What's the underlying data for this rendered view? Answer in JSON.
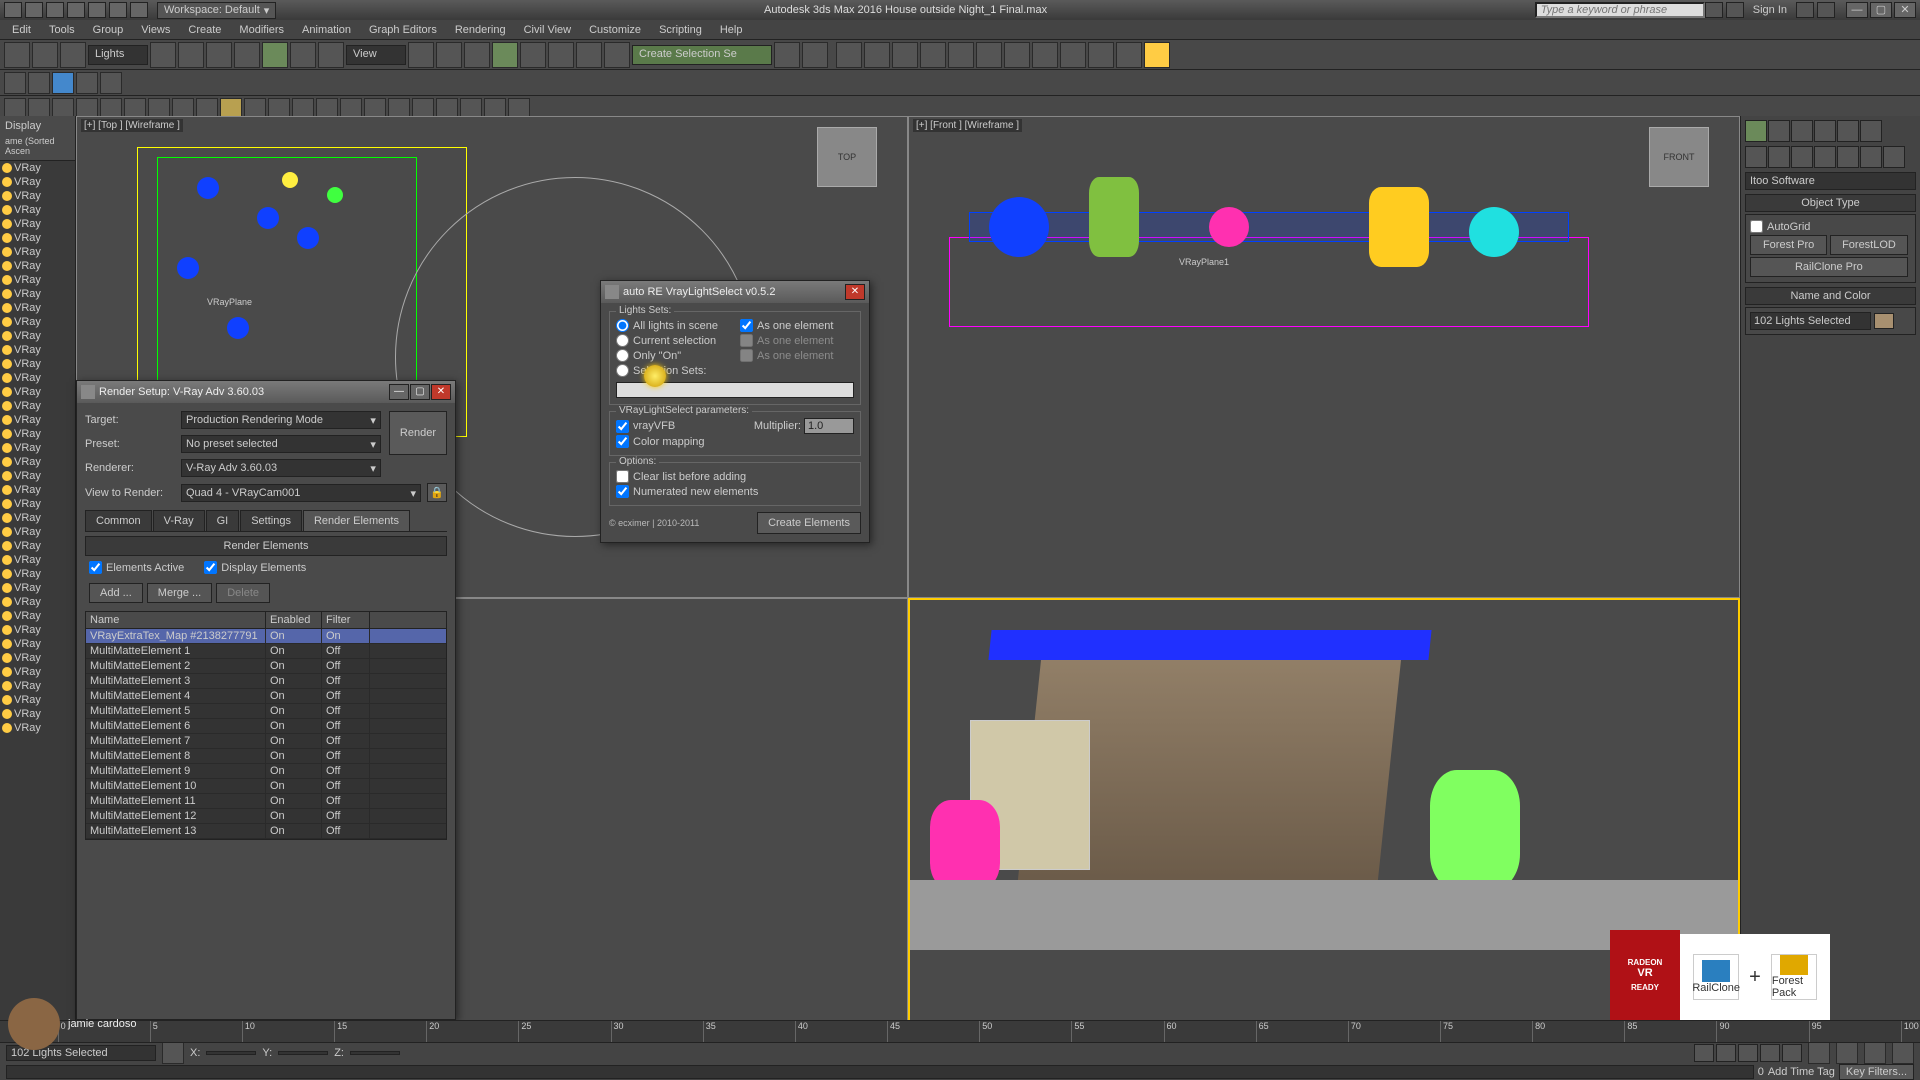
{
  "app": {
    "title": "Autodesk 3ds Max 2016   House outside Night_1 Final.max",
    "workspace_label": "Workspace: Default",
    "search_placeholder": "Type a keyword or phrase",
    "sign_in": "Sign In"
  },
  "menu": [
    "Edit",
    "Tools",
    "Group",
    "Views",
    "Create",
    "Modifiers",
    "Animation",
    "Graph Editors",
    "Rendering",
    "Civil View",
    "Customize",
    "Scripting",
    "Help"
  ],
  "toolbar_dropdowns": {
    "lights": "Lights",
    "view": "View",
    "selset": "Create Selection Se"
  },
  "scene_explorer": {
    "header1": "Display",
    "header2": "ame (Sorted Ascen",
    "items": [
      "VRay",
      "VRay",
      "VRay",
      "VRay",
      "VRay",
      "VRay",
      "VRay",
      "VRay",
      "VRay",
      "VRay",
      "VRay",
      "VRay",
      "VRay",
      "VRay",
      "VRay",
      "VRay",
      "VRay",
      "VRay",
      "VRay",
      "VRay",
      "VRay",
      "VRay",
      "VRay",
      "VRay",
      "VRay",
      "VRay",
      "VRay",
      "VRay",
      "VRay",
      "VRay",
      "VRay",
      "VRay",
      "VRay",
      "VRay",
      "VRay",
      "VRay",
      "VRay",
      "VRay",
      "VRay",
      "VRay",
      "VRay"
    ]
  },
  "viewports": {
    "tl": "[+] [Top ] [Wireframe ]",
    "tr": "[+] [Front ] [Wireframe ]",
    "tl_text": "VRayPlane",
    "tr_text": "VRayPlane1",
    "viewcube_top": "TOP",
    "viewcube_front": "FRONT"
  },
  "cmd_panel": {
    "category": "Itoo Software",
    "rollout_objtype": "Object Type",
    "autogrid": "AutoGrid",
    "buttons": [
      "Forest Pro",
      "ForestLOD",
      "RailClone Pro"
    ],
    "rollout_name": "Name and Color",
    "name_value": "102 Lights Selected"
  },
  "render_setup": {
    "title": "Render Setup: V-Ray Adv 3.60.03",
    "labels": {
      "target": "Target:",
      "preset": "Preset:",
      "renderer": "Renderer:",
      "view": "View to Render:"
    },
    "target": "Production Rendering Mode",
    "preset": "No preset selected",
    "renderer": "V-Ray Adv 3.60.03",
    "view": "Quad 4 - VRayCam001",
    "render_btn": "Render",
    "tabs": [
      "Common",
      "V-Ray",
      "GI",
      "Settings",
      "Render Elements"
    ],
    "active_tab": 4,
    "rollout": "Render Elements",
    "elements_active": "Elements Active",
    "display_elements": "Display Elements",
    "btn_add": "Add ...",
    "btn_merge": "Merge ...",
    "btn_delete": "Delete",
    "cols": {
      "name": "Name",
      "enabled": "Enabled",
      "filter": "Filter"
    },
    "rows": [
      {
        "name": "VRayExtraTex_Map #2138277791",
        "enabled": "On",
        "filter": "On"
      },
      {
        "name": "MultiMatteElement 1",
        "enabled": "On",
        "filter": "Off"
      },
      {
        "name": "MultiMatteElement 2",
        "enabled": "On",
        "filter": "Off"
      },
      {
        "name": "MultiMatteElement 3",
        "enabled": "On",
        "filter": "Off"
      },
      {
        "name": "MultiMatteElement 4",
        "enabled": "On",
        "filter": "Off"
      },
      {
        "name": "MultiMatteElement 5",
        "enabled": "On",
        "filter": "Off"
      },
      {
        "name": "MultiMatteElement 6",
        "enabled": "On",
        "filter": "Off"
      },
      {
        "name": "MultiMatteElement 7",
        "enabled": "On",
        "filter": "Off"
      },
      {
        "name": "MultiMatteElement 8",
        "enabled": "On",
        "filter": "Off"
      },
      {
        "name": "MultiMatteElement 9",
        "enabled": "On",
        "filter": "Off"
      },
      {
        "name": "MultiMatteElement 10",
        "enabled": "On",
        "filter": "Off"
      },
      {
        "name": "MultiMatteElement 11",
        "enabled": "On",
        "filter": "Off"
      },
      {
        "name": "MultiMatteElement 12",
        "enabled": "On",
        "filter": "Off"
      },
      {
        "name": "MultiMatteElement 13",
        "enabled": "On",
        "filter": "Off"
      }
    ]
  },
  "vls": {
    "title": "auto RE VrayLightSelect v0.5.2",
    "group_lights": "Lights Sets:",
    "radios": [
      "All lights in scene",
      "Current selection",
      "Only \"On\"",
      "Selection Sets:"
    ],
    "as_one": "As one element",
    "group_params": "VRayLightSelect parameters:",
    "vrayvfb": "vrayVFB",
    "multiplier_label": "Multiplier:",
    "multiplier": "1.0",
    "color_mapping": "Color mapping",
    "group_options": "Options:",
    "clear_list": "Clear list before adding",
    "numerated": "Numerated new elements",
    "credit": "© ecximer | 2010-2011",
    "create_btn": "Create Elements"
  },
  "timeline": {
    "ticks": [
      "0",
      "5",
      "10",
      "15",
      "20",
      "25",
      "30",
      "35",
      "40",
      "45",
      "50",
      "55",
      "60",
      "65",
      "70",
      "75",
      "80",
      "85",
      "90",
      "95",
      "100"
    ],
    "x": "X:",
    "y": "Y:",
    "z": "Z:",
    "selection": "102 Lights Selected",
    "frame": "0",
    "tags_label": "Add Time Tag",
    "keyfilters": "Key Filters..."
  },
  "overlays": {
    "vr_top": "RADEON",
    "vr": "VR",
    "vr_sub": "READY",
    "rc": "Rc",
    "rc_name": "RailClone",
    "plus": "+",
    "fp": "Fp",
    "fp_name": "Forest Pack"
  },
  "user": {
    "name": "jamie cardoso"
  }
}
